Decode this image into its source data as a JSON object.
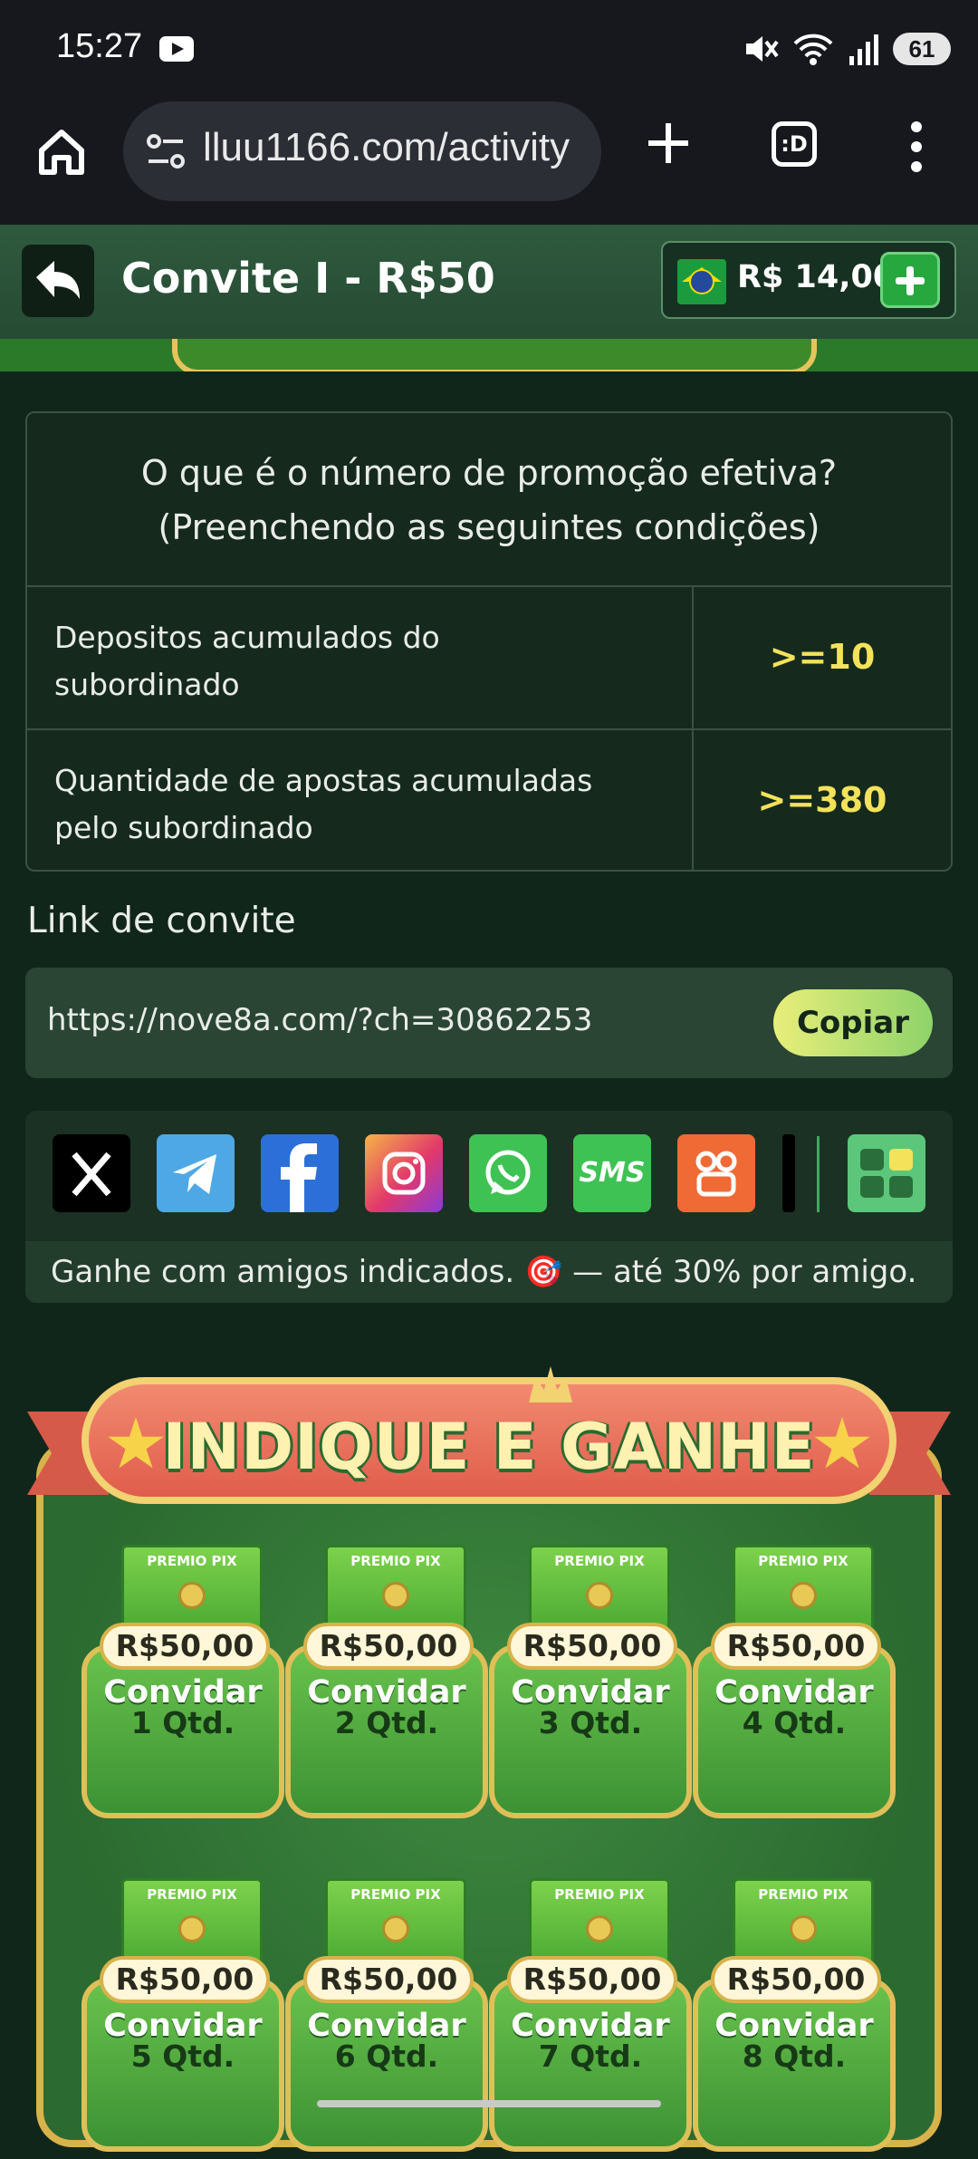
{
  "status_bar": {
    "time": "15:27",
    "battery": "61"
  },
  "browser": {
    "url": "lluu1166.com/activity",
    "tabs_glyph": ":D"
  },
  "header": {
    "title": "Convite I - R$50",
    "balance": "R$ 14,00"
  },
  "conditions": {
    "heading_line1": "O que é o número de promoção efetiva?",
    "heading_line2": "(Preenchendo as seguintes condições)",
    "rows": [
      {
        "label_line1": "Depositos acumulados do",
        "label_line2": "subordinado",
        "value": ">=10"
      },
      {
        "label_line1": "Quantidade de apostas acumuladas",
        "label_line2": "pelo subordinado",
        "value": ">=380"
      }
    ]
  },
  "invite": {
    "title": "Link de convite",
    "link": "https://nove8a.com/?ch=30862253",
    "copy_label": "Copiar"
  },
  "share": {
    "icons": [
      "x-icon",
      "telegram-icon",
      "facebook-icon",
      "instagram-icon",
      "whatsapp-icon",
      "sms-icon",
      "kwai-icon",
      "tiktok-icon",
      "more-apps-icon"
    ],
    "sms_label": "SMS",
    "note": "Ganhe com amigos indicados. 🎯 — até 30% por amigo."
  },
  "promo": {
    "title": "INDIQUE E GANHE",
    "envelope_tag": "PREMIO PIX",
    "cards": [
      {
        "prize": "R$50,00",
        "cta": "Convidar",
        "qty": "1 Qtd."
      },
      {
        "prize": "R$50,00",
        "cta": "Convidar",
        "qty": "2 Qtd."
      },
      {
        "prize": "R$50,00",
        "cta": "Convidar",
        "qty": "3 Qtd."
      },
      {
        "prize": "R$50,00",
        "cta": "Convidar",
        "qty": "4 Qtd."
      },
      {
        "prize": "R$50,00",
        "cta": "Convidar",
        "qty": "5 Qtd."
      },
      {
        "prize": "R$50,00",
        "cta": "Convidar",
        "qty": "6 Qtd."
      },
      {
        "prize": "R$50,00",
        "cta": "Convidar",
        "qty": "7 Qtd."
      },
      {
        "prize": "R$50,00",
        "cta": "Convidar",
        "qty": "8 Qtd."
      }
    ]
  }
}
